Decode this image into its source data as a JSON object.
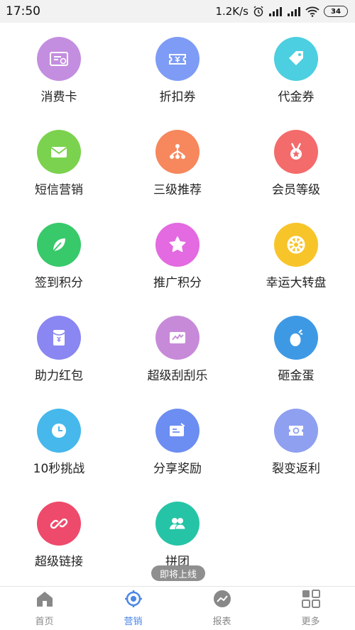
{
  "status_bar": {
    "time": "17:50",
    "speed": "1.2K/s",
    "battery": "34"
  },
  "features": [
    {
      "label": "消费卡",
      "icon": "card-icon",
      "color": "#c48ee0"
    },
    {
      "label": "折扣券",
      "icon": "ticket-icon",
      "color": "#7e9cf5"
    },
    {
      "label": "代金券",
      "icon": "tag-icon",
      "color": "#4ccfe0"
    },
    {
      "label": "短信营销",
      "icon": "mail-icon",
      "color": "#7bd24e"
    },
    {
      "label": "三级推荐",
      "icon": "hierarchy-icon",
      "color": "#f7875d"
    },
    {
      "label": "会员等级",
      "icon": "medal-icon",
      "color": "#f46b6b"
    },
    {
      "label": "签到积分",
      "icon": "leaf-icon",
      "color": "#38c96b"
    },
    {
      "label": "推广积分",
      "icon": "star-icon",
      "color": "#e36ae0"
    },
    {
      "label": "幸运大转盘",
      "icon": "wheel-icon",
      "color": "#f7c52a"
    },
    {
      "label": "助力红包",
      "icon": "red-envelope-icon",
      "color": "#8a86f2"
    },
    {
      "label": "超级刮刮乐",
      "icon": "scratch-card-icon",
      "color": "#c78ad9"
    },
    {
      "label": "砸金蛋",
      "icon": "egg-icon",
      "color": "#3e99e5"
    },
    {
      "label": "10秒挑战",
      "icon": "clock-icon",
      "color": "#46b8ec"
    },
    {
      "label": "分享奖励",
      "icon": "share-card-icon",
      "color": "#6c8ef2"
    },
    {
      "label": "裂变返利",
      "icon": "coupon-icon",
      "color": "#8fa0f0"
    },
    {
      "label": "超级链接",
      "icon": "link-icon",
      "color": "#ee4a6b"
    },
    {
      "label": "拼团",
      "icon": "group-icon",
      "color": "#26c4a6"
    }
  ],
  "coming_soon": "即将上线",
  "nav": [
    {
      "label": "首页",
      "icon": "home-icon",
      "active": false
    },
    {
      "label": "营销",
      "icon": "target-icon",
      "active": true
    },
    {
      "label": "报表",
      "icon": "chart-icon",
      "active": false
    },
    {
      "label": "更多",
      "icon": "grid-icon",
      "active": false
    }
  ],
  "colors": {
    "accent": "#4a86e8",
    "nav_inactive": "#888888"
  }
}
